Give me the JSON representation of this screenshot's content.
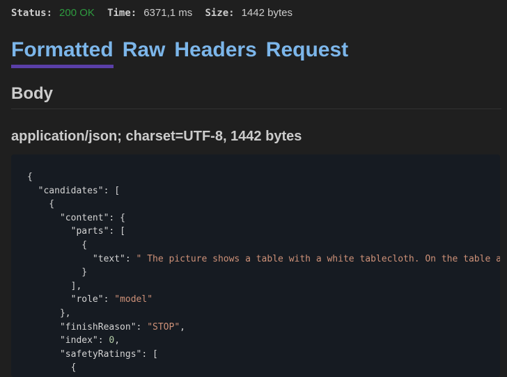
{
  "status": {
    "status_label": "Status:",
    "status_value": "200 OK",
    "time_label": "Time:",
    "time_value": "6371,1 ms",
    "size_label": "Size:",
    "size_value": "1442 bytes"
  },
  "tabs": [
    {
      "label": "Formatted",
      "active": true
    },
    {
      "label": "Raw",
      "active": false
    },
    {
      "label": "Headers",
      "active": false
    },
    {
      "label": "Request",
      "active": false
    }
  ],
  "section": {
    "title": "Body"
  },
  "content_type": "application/json; charset=UTF-8, 1442 bytes",
  "json": {
    "brace_open": "{",
    "candidates_key": "\"candidates\"",
    "content_key": "\"content\"",
    "parts_key": "\"parts\"",
    "text_key": "\"text\"",
    "text_value": "\" The picture shows a table with a white tablecloth. On the table are",
    "role_key": "\"role\"",
    "role_value": "\"model\"",
    "finish_key": "\"finishReason\"",
    "finish_value": "\"STOP\"",
    "index_key": "\"index\"",
    "index_value": "0",
    "safety_key": "\"safetyRatings\""
  },
  "colors": {
    "background": "#1f1f1f",
    "code_background": "#161b22",
    "tab_text": "#7cb6ea",
    "tab_underline": "#5a3fa8",
    "status_ok": "#2e9b3f",
    "json_string": "#ce9178",
    "json_number": "#b5cea8"
  }
}
